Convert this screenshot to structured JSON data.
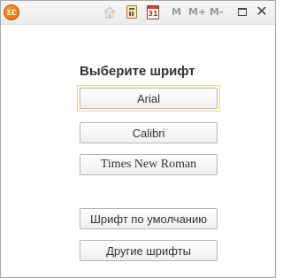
{
  "titlebar": {
    "logo_text": "1С",
    "icons": [
      "home-icon",
      "calculator-icon",
      "calendar-icon"
    ],
    "calendar_day": "31",
    "memory_buttons": {
      "m": "M",
      "m_plus": "M+",
      "m_minus": "M-"
    },
    "restore_icon": "restore-icon",
    "close_glyph": "✕"
  },
  "dialog": {
    "heading": "Выберите шрифт",
    "buttons": {
      "arial": "Arial",
      "calibri": "Calibri",
      "times": "Times New Roman",
      "default_font": "Шрифт по умолчанию",
      "other_fonts": "Другие шрифты"
    }
  },
  "colors": {
    "logo": "#e8620c",
    "focus_border": "#f2d77a",
    "button_border": "#b5b5b5"
  }
}
